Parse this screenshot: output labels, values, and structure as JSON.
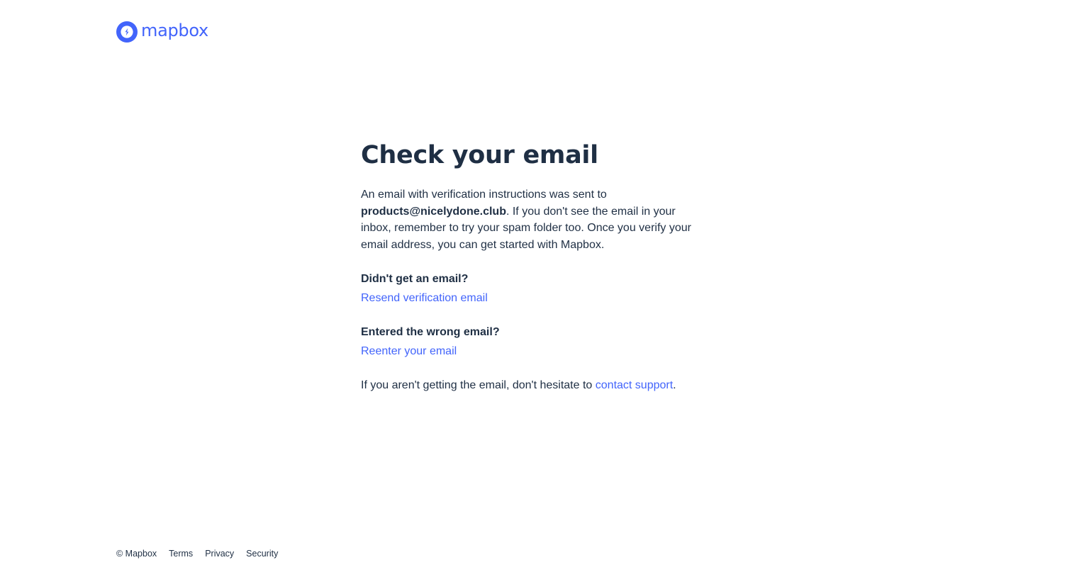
{
  "brand": {
    "name": "mapbox",
    "color": "#4264fb"
  },
  "main": {
    "title": "Check your email",
    "intro_prefix": "An email with verification instructions was sent to",
    "email": "products@nicelydone.club",
    "intro_suffix": ". If you don't see the email in your inbox, remember to try your spam folder too. Once you verify your email address, you can get started with Mapbox."
  },
  "resend": {
    "heading": "Didn't get an email?",
    "link": "Resend verification email"
  },
  "reenter": {
    "heading": "Entered the wrong email?",
    "link": "Reenter your email"
  },
  "support": {
    "prefix": "If you aren't getting the email, don't hesitate to ",
    "link": "contact support",
    "suffix": "."
  },
  "footer": {
    "copyright": "© Mapbox",
    "links": [
      "Terms",
      "Privacy",
      "Security"
    ]
  },
  "colors": {
    "text": "#1f2f44",
    "link": "#4264fb",
    "background": "#ffffff"
  }
}
